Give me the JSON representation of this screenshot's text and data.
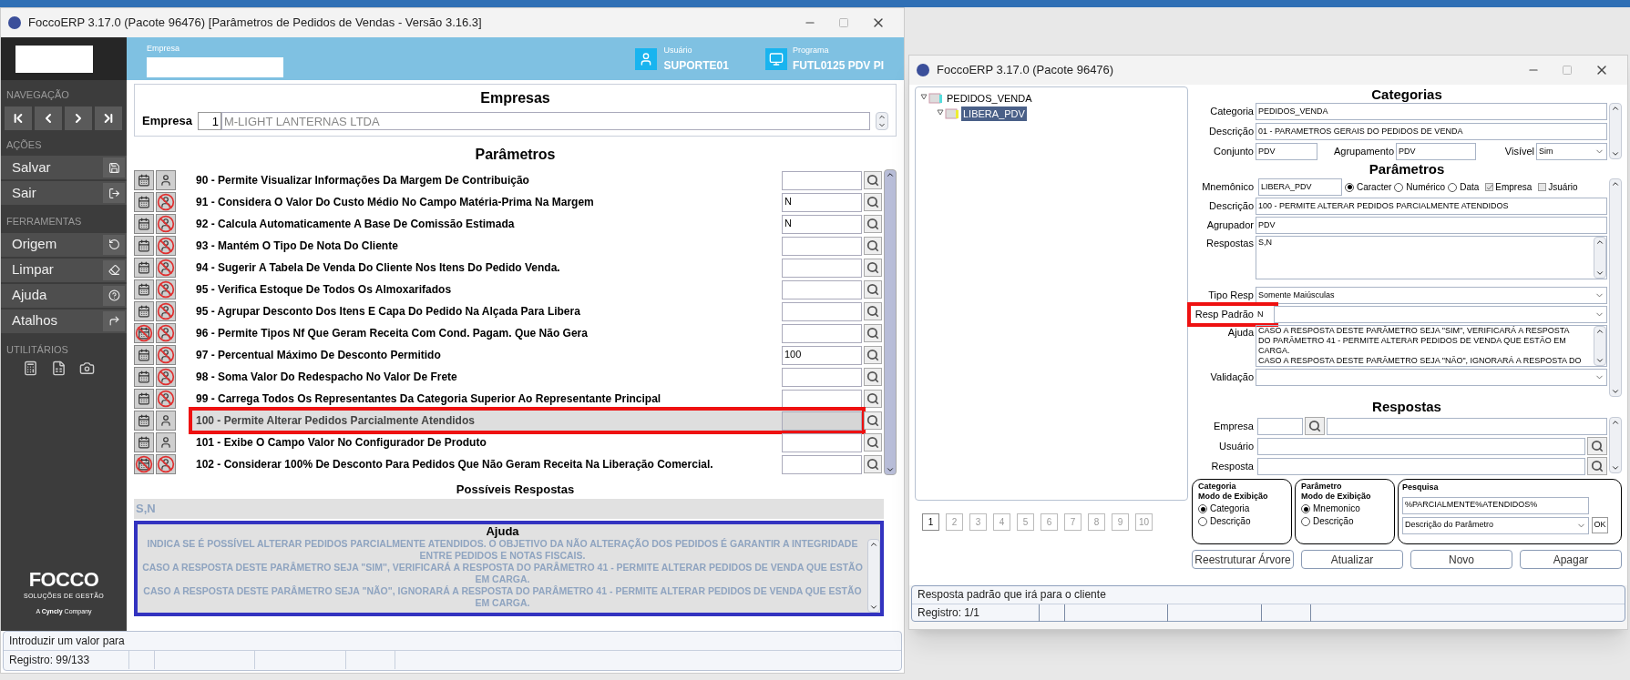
{
  "left_window": {
    "title": "FoccoERP 3.17.0 (Pacote 96476) [Parâmetros de Pedidos de Vendas - Versão 3.16.3]"
  },
  "sidebar": {
    "sections": [
      {
        "label": "NAVEGAÇÃO",
        "kind": "nav",
        "items": [
          {
            "kind": "first"
          },
          {
            "kind": "prev"
          },
          {
            "kind": "next"
          },
          {
            "kind": "last"
          }
        ]
      },
      {
        "label": "AÇÕES",
        "kind": "actions",
        "items": [
          {
            "label": "Salvar",
            "kind": "save"
          },
          {
            "label": "Sair",
            "kind": "exit"
          }
        ]
      },
      {
        "label": "FERRAMENTAS",
        "kind": "actions",
        "items": [
          {
            "label": "Origem",
            "kind": "undo"
          },
          {
            "label": "Limpar",
            "kind": "erase"
          },
          {
            "label": "Ajuda",
            "kind": "help"
          },
          {
            "label": "Atalhos",
            "kind": "shortcut"
          }
        ]
      },
      {
        "label": "UTILITÁRIOS",
        "kind": "utils",
        "items": [
          {
            "kind": "calculator"
          },
          {
            "kind": "excel"
          },
          {
            "kind": "camera"
          }
        ]
      }
    ],
    "logo": {
      "name": "FOCCO",
      "tagline": "SOLUÇÕES DE GESTÃO",
      "company_prefix": "A",
      "company_brand": "Cyncly",
      "company_suffix": "Company"
    }
  },
  "header": {
    "empresa_label": "Empresa",
    "usuario_label": "Usuário",
    "usuario": "SUPORTE01",
    "programa_label": "Programa",
    "programa": "FUTL0125 PDV PI"
  },
  "empresas": {
    "title": "Empresas",
    "label": "Empresa",
    "code": "1",
    "name": "M-LIGHT LANTERNAS LTDA"
  },
  "parametros": {
    "title": "Parâmetros",
    "rows": [
      {
        "label": "90 - Permite Visualizar Informações Da Margem De Contribuição",
        "value": "",
        "calendar_blocked": false,
        "user_blocked": false,
        "selected": false
      },
      {
        "label": "91 - Considera O Valor Do Custo Médio No Campo Matéria-Prima Na Margem",
        "value": "N",
        "calendar_blocked": false,
        "user_blocked": true,
        "selected": false
      },
      {
        "label": "92 - Calcula Automaticamente A Base De Comissão Estimada",
        "value": "N",
        "calendar_blocked": false,
        "user_blocked": true,
        "selected": false
      },
      {
        "label": "93 - Mantém O Tipo De Nota Do Cliente",
        "value": "",
        "calendar_blocked": false,
        "user_blocked": true,
        "selected": false
      },
      {
        "label": "94 - Sugerir A Tabela De Venda Do Cliente Nos Itens Do Pedido Venda.",
        "value": "",
        "calendar_blocked": false,
        "user_blocked": true,
        "selected": false
      },
      {
        "label": "95 - Verifica Estoque De Todos Os Almoxarifados",
        "value": "",
        "calendar_blocked": false,
        "user_blocked": true,
        "selected": false
      },
      {
        "label": "95 - Agrupar Desconto Dos Itens E Capa Do Pedido Na Alçada Para Libera",
        "value": "",
        "calendar_blocked": false,
        "user_blocked": true,
        "selected": false
      },
      {
        "label": "96 - Permite Tipos Nf Que Geram Receita Com Cond. Pagam. Que Não Gera",
        "value": "",
        "calendar_blocked": true,
        "user_blocked": true,
        "selected": false
      },
      {
        "label": "97 - Percentual Máximo De Desconto Permitido",
        "value": "100",
        "calendar_blocked": false,
        "user_blocked": true,
        "selected": false
      },
      {
        "label": "98 - Soma Valor Do Redespacho No Valor De Frete",
        "value": "",
        "calendar_blocked": false,
        "user_blocked": true,
        "selected": false
      },
      {
        "label": "99 - Carrega Todos Os Representantes Da Categoria Superior Ao Representante Principal",
        "value": "",
        "calendar_blocked": false,
        "user_blocked": true,
        "selected": false
      },
      {
        "label": "100 - Permite Alterar Pedidos Parcialmente Atendidos",
        "value": "",
        "calendar_blocked": false,
        "user_blocked": false,
        "selected": true,
        "highlighted": true
      },
      {
        "label": "101 - Exibe O Campo Valor No Configurador De Produto",
        "value": "",
        "calendar_blocked": false,
        "user_blocked": false,
        "selected": false
      },
      {
        "label": "102 - Considerar 100% De Desconto Para Pedidos Que Não Geram Receita Na Liberação Comercial.",
        "value": "",
        "calendar_blocked": true,
        "user_blocked": true,
        "selected": false
      }
    ]
  },
  "possiveis_respostas": {
    "title": "Possíveis Respostas",
    "value": "S,N"
  },
  "ajuda": {
    "title": "Ajuda",
    "highlighted": true,
    "paragraphs": [
      "INDICA SE É POSSÍVEL ALTERAR PEDIDOS PARCIALMENTE ATENDIDOS. O OBJETIVO DA NÃO ALTERAÇÃO DOS PEDIDOS É GARANTIR A INTEGRIDADE ENTRE PEDIDOS E NOTAS FISCAIS.",
      "CASO A RESPOSTA DESTE PARÂMETRO SEJA \"SIM\", VERIFICARÁ A RESPOSTA DO PARÂMETRO 41 -  PERMITE ALTERAR PEDIDOS DE VENDA QUE ESTÃO EM CARGA.",
      "CASO A RESPOSTA DESTE PARÂMETRO SEJA \"NÃO\", IGNORARÁ A RESPOSTA DO PARÂMETRO 41 - PERMITE ALTERAR PEDIDOS DE VENDA QUE ESTÃO EM CARGA."
    ]
  },
  "left_status": {
    "message": "Introduzir um valor para",
    "record": "Registro: 99/133"
  },
  "right_window": {
    "title": "FoccoERP 3.17.0 (Pacote 96476)"
  },
  "tree": {
    "items": [
      {
        "label": "PEDIDOS_VENDA",
        "selected": false,
        "children": [
          {
            "label": "LIBERA_PDV",
            "selected": true
          }
        ]
      }
    ]
  },
  "pages": [
    {
      "label": "1",
      "selected": true
    },
    {
      "label": "2",
      "selected": false
    },
    {
      "label": "3",
      "selected": false
    },
    {
      "label": "4",
      "selected": false
    },
    {
      "label": "5",
      "selected": false
    },
    {
      "label": "6",
      "selected": false
    },
    {
      "label": "7",
      "selected": false
    },
    {
      "label": "8",
      "selected": false
    },
    {
      "label": "9",
      "selected": false
    },
    {
      "label": "10",
      "selected": false
    }
  ],
  "categorias": {
    "title": "Categorias",
    "categoria_label": "Categoria",
    "categoria": "PEDIDOS_VENDA",
    "descricao_label": "Descrição",
    "descricao": "01 - PARAMETROS GERAIS DO PEDIDOS DE VENDA",
    "conjunto_label": "Conjunto",
    "conjunto": "PDV",
    "agrupamento_label": "Agrupamento",
    "agrupamento": "PDV",
    "visivel_label": "Visível",
    "visivel": "Sim"
  },
  "param_form": {
    "title": "Parâmetros",
    "mnemonico_label": "Mnemônico",
    "mnemonico": "LIBERA_PDV",
    "types": [
      {
        "label": "Caracter",
        "selected": true
      },
      {
        "label": "Numérico",
        "selected": false
      },
      {
        "label": "Data",
        "selected": false
      }
    ],
    "flags": [
      {
        "label": "Empresa",
        "checked": true
      },
      {
        "label": "Jsuário",
        "checked": false
      }
    ],
    "descricao_label": "Descrição",
    "descricao": "100 - PERMITE ALTERAR PEDIDOS PARCIALMENTE ATENDIDOS",
    "agrupador_label": "Agrupador",
    "agrupador": "PDV",
    "respostas_label": "Respostas",
    "respostas": "S,N",
    "tipo_resp_label": "Tipo Resp",
    "tipo_resp": "Somente Maiúsculas",
    "resp_padrao_label": "Resp Padrão",
    "resp_padrao": "N",
    "resp_padrao_highlighted": true,
    "ajuda_label": "Ajuda",
    "ajuda_lines": [
      "CASO A RESPOSTA DESTE PARÂMETRO SEJA \"SIM\", VERIFICARÁ A RESPOSTA",
      "DO PARÂMETRO 41 -  PERMITE ALTERAR PEDIDOS DE VENDA QUE ESTÃO EM",
      "CARGA.",
      "CASO A RESPOSTA DESTE PARÂMETRO SEJA \"NÃO\", IGNORARÁ A RESPOSTA DO"
    ],
    "validacao_label": "Validação"
  },
  "respostas_form": {
    "title": "Respostas",
    "empresa_label": "Empresa",
    "usuario_label": "Usuário",
    "resposta_label": "Resposta"
  },
  "groups": [
    {
      "title": "Categoria",
      "subtitle": "Modo de Exibição",
      "options": [
        {
          "label": "Categoria",
          "selected": true
        },
        {
          "label": "Descrição",
          "selected": false
        }
      ]
    },
    {
      "title": "Parâmetro",
      "subtitle": "Modo de Exibição",
      "options": [
        {
          "label": "Mnemonico",
          "selected": true
        },
        {
          "label": "Descrição",
          "selected": false
        }
      ]
    }
  ],
  "pesquisa": {
    "title": "Pesquisa",
    "value": "%PARCIALMENTE%ATENDIDOS%",
    "mode": "Descrição do Parâmetro",
    "ok": "OK"
  },
  "buttons": [
    "Reestruturar Árvore",
    "Atualizar",
    "Novo",
    "Apagar"
  ],
  "right_status": {
    "message": "Resposta padrão que irá para o cliente",
    "record": "Registro: 1/1"
  }
}
